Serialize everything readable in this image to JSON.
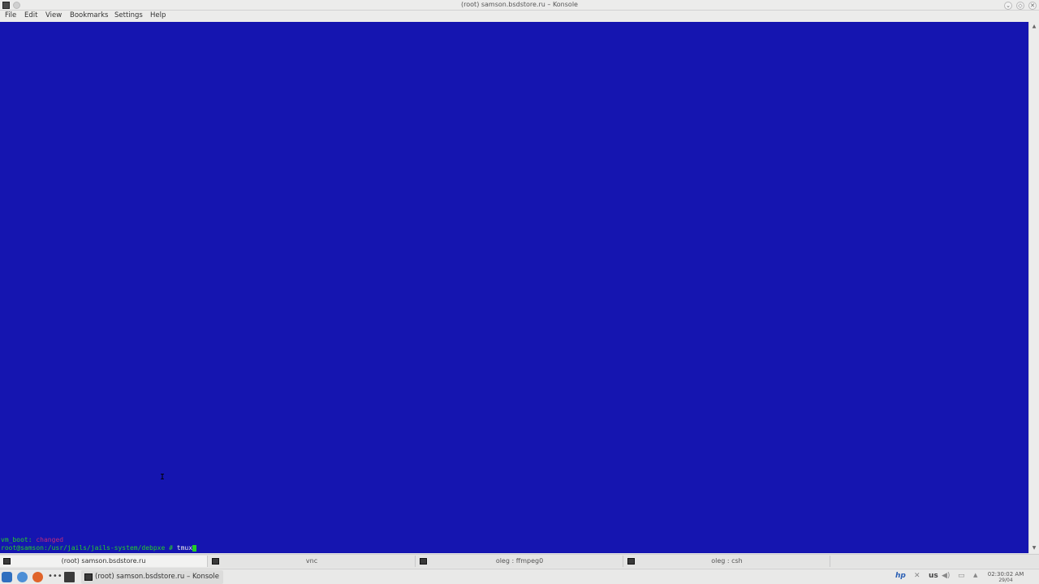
{
  "window": {
    "title": "(root) samson.bsdstore.ru – Konsole",
    "buttons": {
      "minimize": "⌄",
      "maximize": "◇",
      "close": "✕"
    }
  },
  "menu": [
    "File",
    "Edit",
    "View",
    "Bookmarks",
    "Settings",
    "Help"
  ],
  "terminal": {
    "line1_label": "vm_boot:",
    "line1_value": "changed",
    "prompt": "root@samson:/usr/jails/jails-system/debpxe #",
    "command": "tmux",
    "colors": {
      "background": "#1515b0",
      "label": "#27d027",
      "changed": "#c02c7a",
      "prompt": "#27d027",
      "command": "#e8e8e8"
    }
  },
  "tabs": [
    {
      "label": "(root) samson.bsdstore.ru",
      "active": true
    },
    {
      "label": "vnc",
      "active": false
    },
    {
      "label": "oleg : ffmpeg0",
      "active": false
    },
    {
      "label": "oleg : csh",
      "active": false
    }
  ],
  "taskbar": {
    "launchers": [
      "kde-menu-icon",
      "chromium-icon",
      "firefox-icon",
      "dots-icon",
      "terminal-icon"
    ],
    "active_task": "(root) samson.bsdstore.ru – Konsole",
    "tray": {
      "keyboard_layout": "us"
    },
    "clock": {
      "time": "02:30:02 AM",
      "date": "29/04"
    }
  }
}
